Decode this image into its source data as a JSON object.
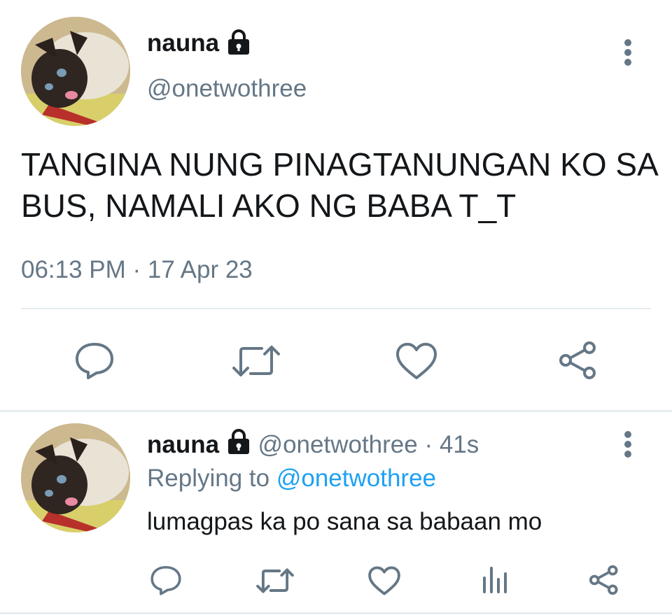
{
  "main_tweet": {
    "display_name": "nauna",
    "handle": "@onetwothree",
    "text": "TANGINA NUNG PINAGTANUNGAN KO SA BUS, NAMALI AKO NG BABA T_T",
    "timestamp": "06:13 PM · 17 Apr 23",
    "actions": [
      "reply-icon",
      "retweet-icon",
      "like-icon",
      "share-icon"
    ]
  },
  "reply_tweet": {
    "display_name": "nauna",
    "handle": "@onetwothree",
    "time_ago": "· 41s",
    "replying_to_label": "Replying to",
    "replying_to_handle": "@onetwothree",
    "text": "lumagpas ka po sana sa babaan mo",
    "actions": [
      "reply-icon",
      "retweet-icon",
      "like-icon",
      "analytics-icon",
      "share-icon"
    ]
  },
  "colors": {
    "text": "#14171a",
    "secondary": "#657786",
    "link": "#1da1f2",
    "divider": "#e6ecf0"
  }
}
